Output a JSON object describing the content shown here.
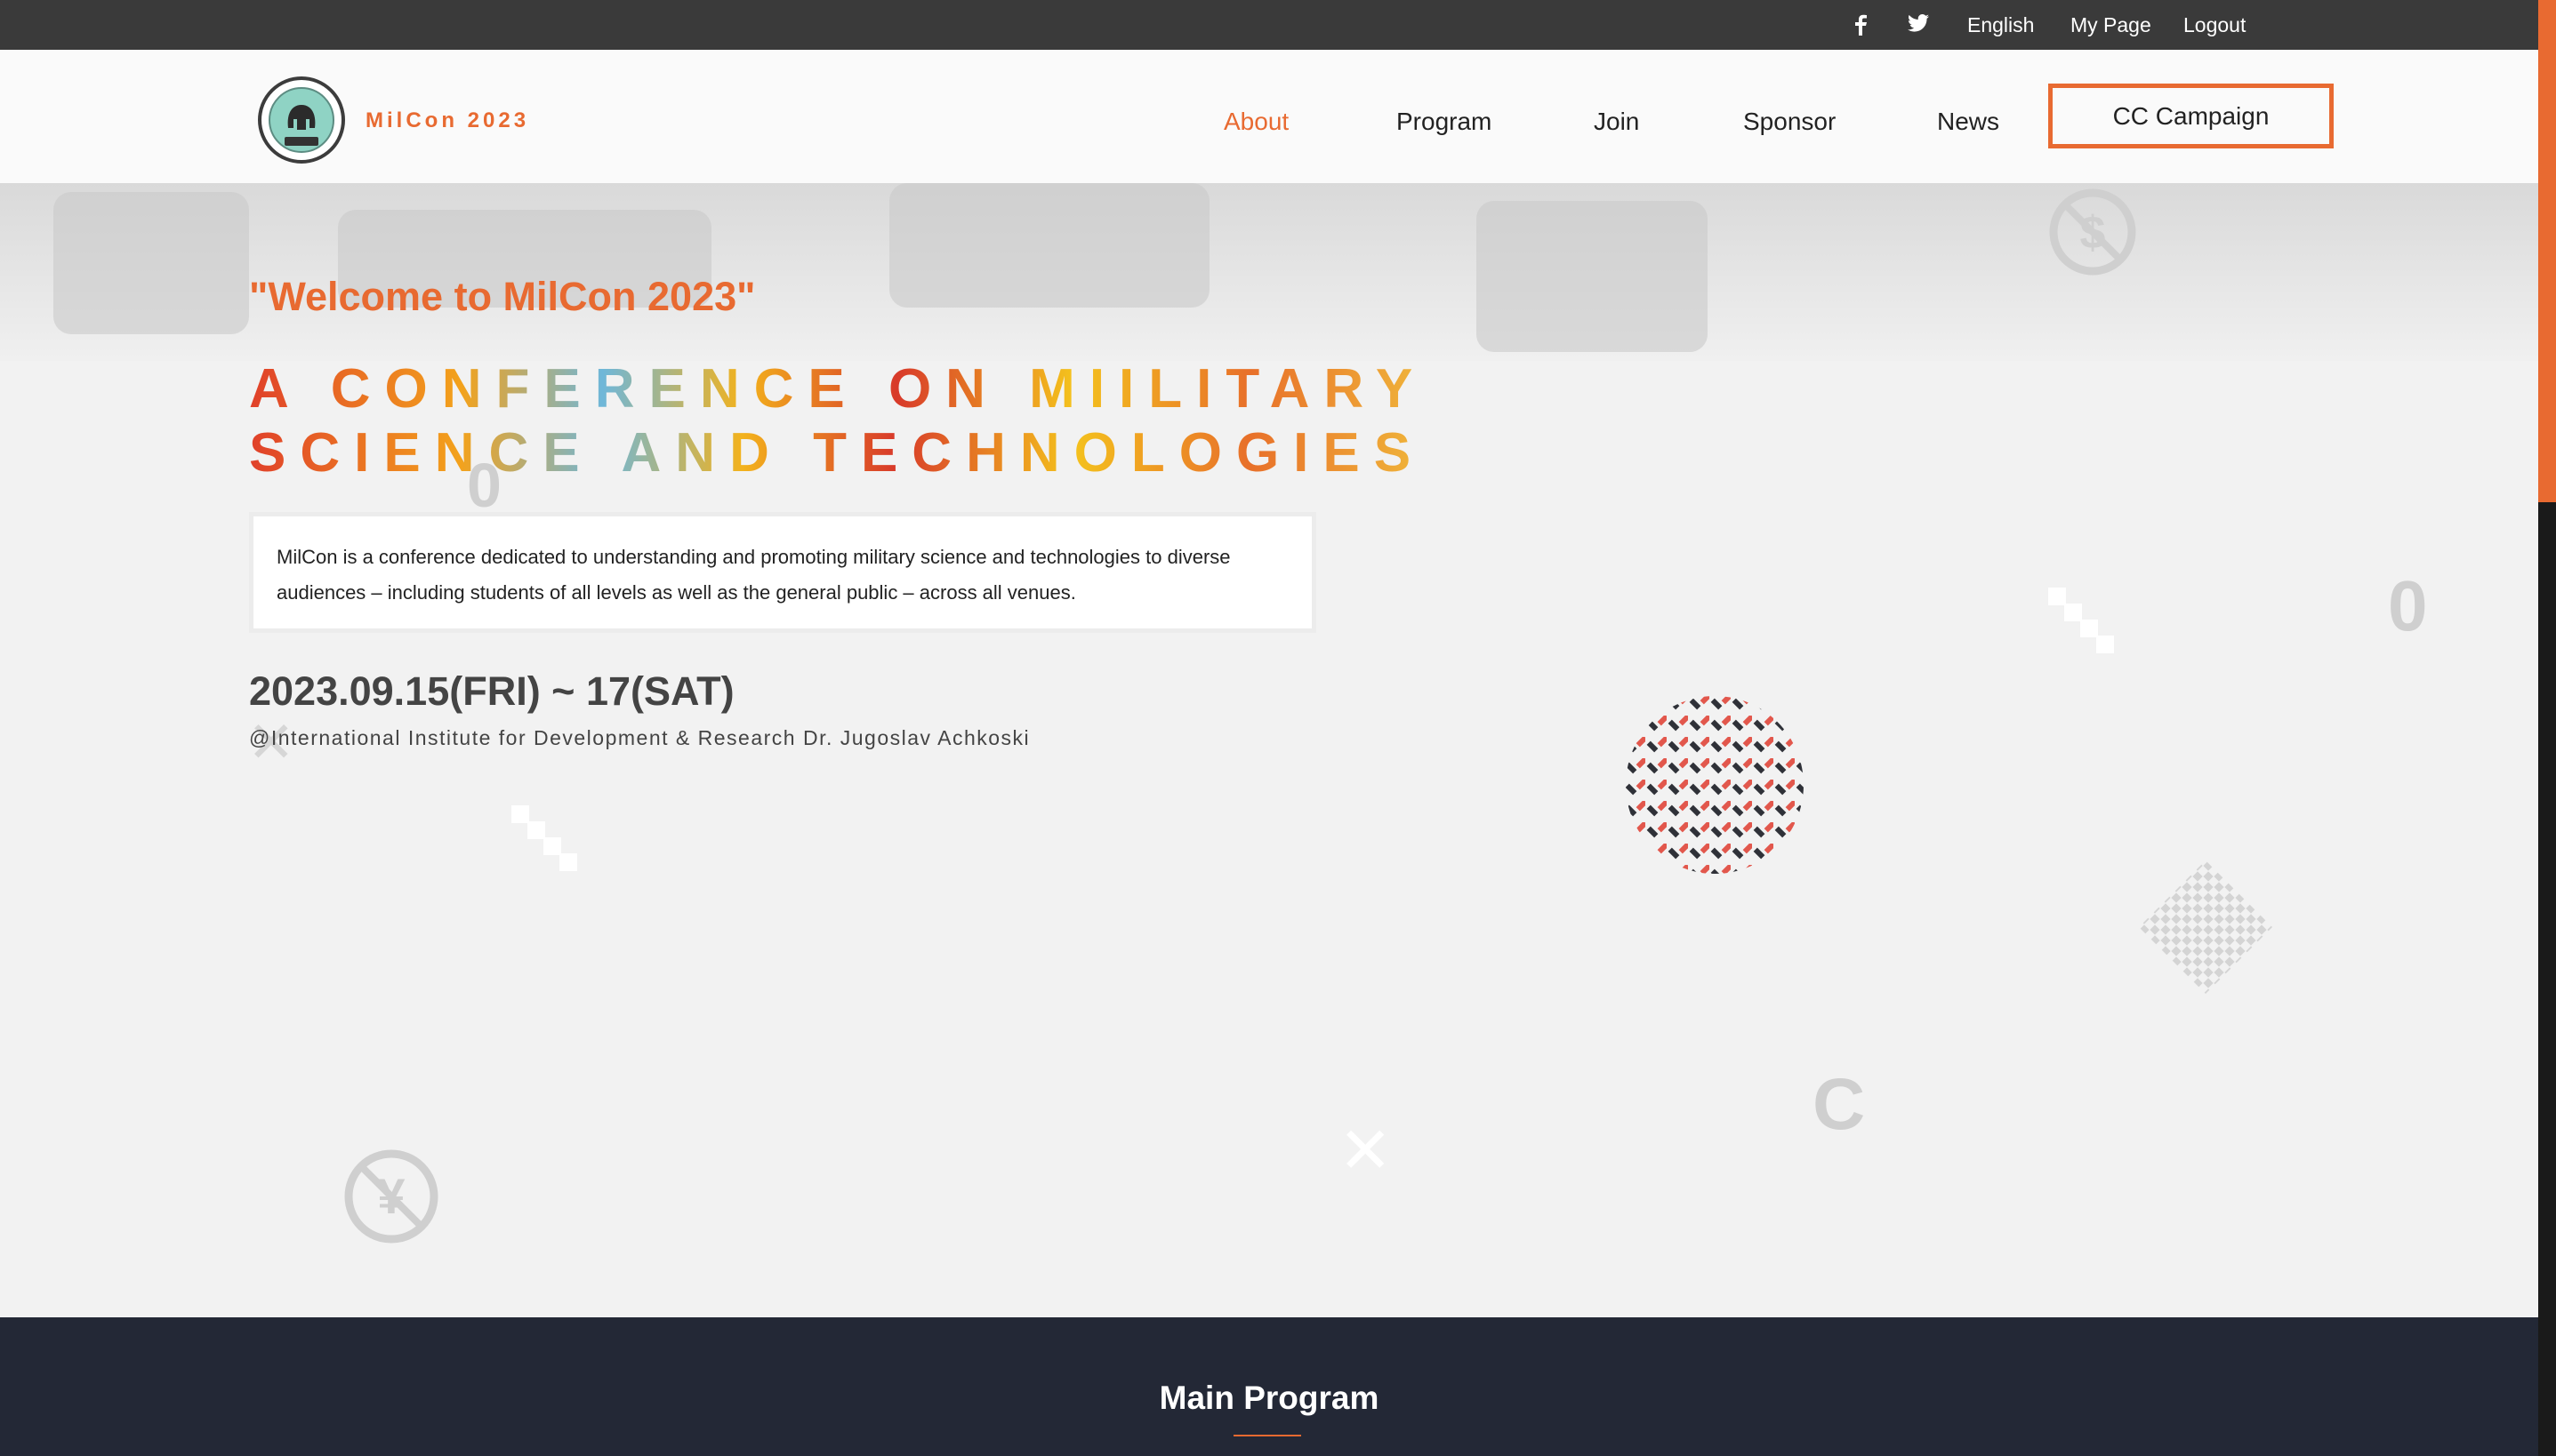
{
  "topbar": {
    "facebook_icon": "facebook-icon",
    "twitter_icon": "twitter-icon",
    "language": "English",
    "my_page": "My Page",
    "logout": "Logout"
  },
  "header": {
    "brand": "MilCon 2023",
    "nav": {
      "about": "About",
      "program": "Program",
      "join": "Join",
      "sponsor": "Sponsor",
      "news": "News",
      "cta": "CC Campaign"
    }
  },
  "hero": {
    "welcome": "\"Welcome to MilCon 2023\"",
    "headline_line1": "A CONFERENCE ON MIILITARY",
    "headline_line2": "SCIENCE AND TECHNOLOGIES",
    "description": "MilCon is a conference dedicated to understanding and promoting military science and technologies to diverse audiences – including students of all levels as well as the general public – across all venues.",
    "date": "2023.09.15(FRI) ~ 17(SAT)",
    "venue": "@International Institute for Development & Research Dr. Jugoslav Achkoski",
    "decor_glyphs": {
      "zero": "0",
      "cross": "✕",
      "copyright": "C"
    }
  },
  "program": {
    "title": "Main Program"
  },
  "colors": {
    "accent": "#e86a31",
    "topbar": "#3a3a3a",
    "band": "#232836"
  }
}
